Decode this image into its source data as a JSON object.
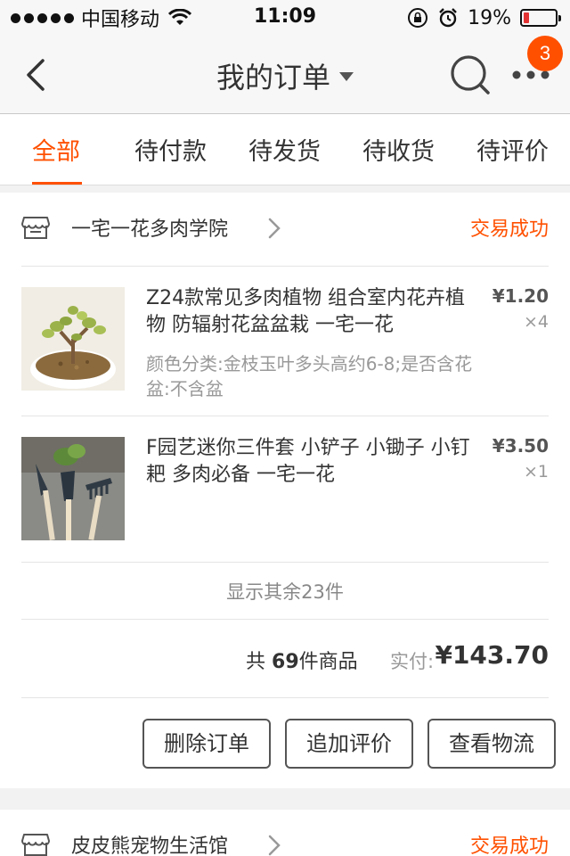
{
  "status_bar": {
    "carrier": "中国移动",
    "time": "11:09",
    "battery_percent": "19%",
    "battery_level": 0.19,
    "battery_color": "#e33333"
  },
  "nav": {
    "title": "我的订单",
    "badge_count": "3",
    "icons": [
      "back-chevron-icon",
      "search-icon",
      "more-icon"
    ]
  },
  "tabs": [
    {
      "label": "全部",
      "active": true
    },
    {
      "label": "待付款",
      "active": false
    },
    {
      "label": "待发货",
      "active": false
    },
    {
      "label": "待收货",
      "active": false
    },
    {
      "label": "待评价",
      "active": false
    }
  ],
  "accent_color": "#ff5000",
  "orders": [
    {
      "shop_name": "一宅一花多肉学院",
      "status": "交易成功",
      "items": [
        {
          "title": "Z24款常见多肉植物 组合室内花卉植物 防辐射花盆盆栽 一宅一花",
          "spec": "颜色分类:金枝玉叶多头高约6-8;是否含花盆:不含盆",
          "price": "¥1.20",
          "qty": "×4"
        },
        {
          "title": "F园艺迷你三件套 小铲子 小锄子 小钉耙 多肉必备 一宅一花",
          "spec": "",
          "price": "¥3.50",
          "qty": "×1"
        }
      ],
      "more_items": "显示其余23件",
      "summary": {
        "prefix": "共",
        "count": "69",
        "suffix": "件商品",
        "paid_label": "实付:",
        "paid_amount": "¥143.70"
      },
      "actions": [
        "删除订单",
        "追加评价",
        "查看物流"
      ]
    },
    {
      "shop_name": "皮皮熊宠物生活馆",
      "status": "交易成功"
    }
  ]
}
